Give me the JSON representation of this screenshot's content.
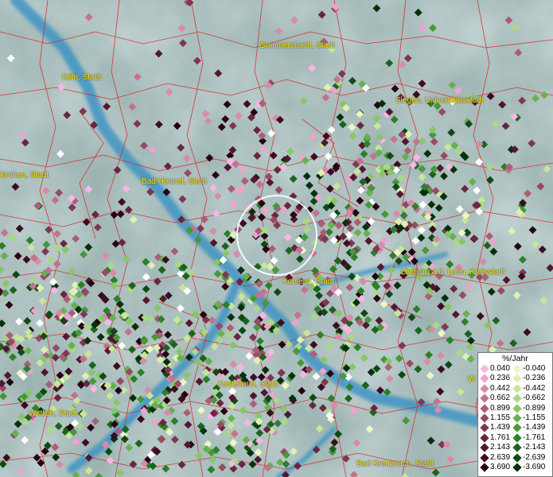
{
  "cities": [
    {
      "label": "Köln, Stadt"
    },
    {
      "label": "Gummersbach, Stadt"
    },
    {
      "label": "Siegen, Universitätsstadt"
    },
    {
      "label": "kirchen, Stadt"
    },
    {
      "label": "Bad Honnef, Stadt"
    },
    {
      "label": "Koblenz, Stadt"
    },
    {
      "label": "Limburg a.d. Lahn, Kreisstadt"
    },
    {
      "label": "Kastellaun, Stadt"
    },
    {
      "label": "Wittlich, Stadt"
    },
    {
      "label": "Bad Kreuznach, Stadt"
    },
    {
      "label": "W"
    }
  ],
  "legend": {
    "title": "%/Jahr",
    "rows": [
      {
        "pos": "0.040",
        "neg": "-0.040",
        "pos_color": "#f8b6e6",
        "neg_color": "#eef7c4"
      },
      {
        "pos": "0.236",
        "neg": "-0.236",
        "pos_color": "#eea2ce",
        "neg_color": "#dff0b0"
      },
      {
        "pos": "0.442",
        "neg": "-0.442",
        "pos_color": "#d98aab",
        "neg_color": "#c7e699"
      },
      {
        "pos": "0.662",
        "neg": "-0.662",
        "pos_color": "#c4728f",
        "neg_color": "#aad886"
      },
      {
        "pos": "0.899",
        "neg": "-0.899",
        "pos_color": "#ad5d78",
        "neg_color": "#88c66a"
      },
      {
        "pos": "1.155",
        "neg": "-1.155",
        "pos_color": "#974a63",
        "neg_color": "#66b14f"
      },
      {
        "pos": "1.439",
        "neg": "-1.439",
        "pos_color": "#7f3750",
        "neg_color": "#46983a"
      },
      {
        "pos": "1.761",
        "neg": "-1.761",
        "pos_color": "#69263f",
        "neg_color": "#2d7f2a"
      },
      {
        "pos": "2.143",
        "neg": "-2.143",
        "pos_color": "#53172f",
        "neg_color": "#1b641e"
      },
      {
        "pos": "2.639",
        "neg": "-2.639",
        "pos_color": "#3d0c20",
        "neg_color": "#0e4a14"
      },
      {
        "pos": "3.690",
        "neg": "-3.690",
        "pos_color": "#260412",
        "neg_color": "#07300b"
      }
    ]
  },
  "colors": {
    "terrain": "#8aa5a3",
    "river": "#3f94c4",
    "boundary": "#dc2020",
    "label": "#ffea00"
  }
}
